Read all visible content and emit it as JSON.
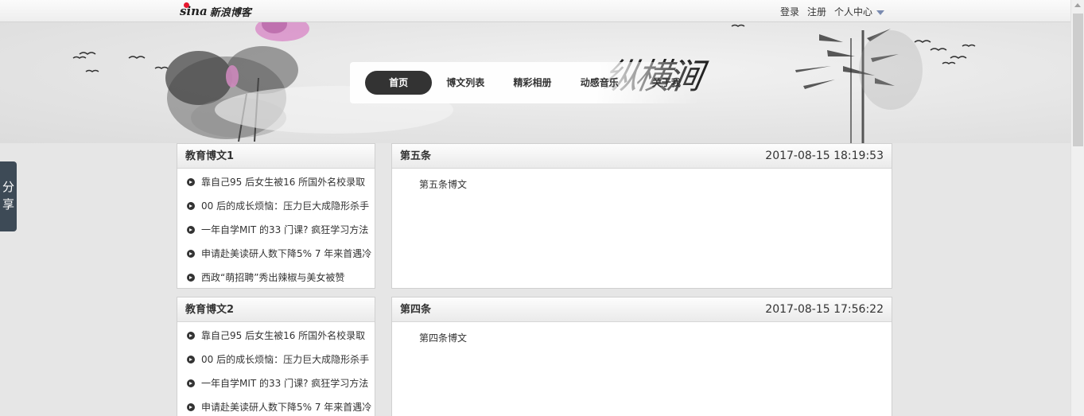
{
  "topbar": {
    "logo_text": "sina",
    "logo_blog": "新浪博客",
    "login": "登录",
    "register": "注册",
    "personal_center": "个人中心"
  },
  "nav": {
    "items": [
      "首页",
      "博文列表",
      "精彩相册",
      "动感音乐",
      "关于我"
    ],
    "active_index": 0
  },
  "header": {
    "calligraphy": "纵横涧"
  },
  "share": {
    "label_1": "分",
    "label_2": "享"
  },
  "sidebar": {
    "modules": [
      {
        "title": "教育博文1",
        "items": [
          "靠自己95 后女生被16 所国外名校录取",
          "00 后的成长烦恼：压力巨大成隐形杀手",
          "一年自学MIT 的33 门课? 疯狂学习方法",
          "申请赴美读研人数下降5% 7 年来首遇冷",
          "西政“萌招聘”秀出辣椒与美女被赞"
        ]
      },
      {
        "title": "教育博文2",
        "items": [
          "靠自己95 后女生被16 所国外名校录取",
          "00 后的成长烦恼：压力巨大成隐形杀手",
          "一年自学MIT 的33 门课? 疯狂学习方法",
          "申请赴美读研人数下降5% 7 年来首遇冷"
        ]
      }
    ]
  },
  "articles": [
    {
      "title": "第五条",
      "time": "2017-08-15 18:19:53",
      "body": "第五条博文"
    },
    {
      "title": "第四条",
      "time": "2017-08-15 17:56:22",
      "body": "第四条博文"
    }
  ],
  "colors": {
    "nav_active_bg": "#333333",
    "logo_red": "#e6162d",
    "share_bg": "#3d4a56"
  }
}
